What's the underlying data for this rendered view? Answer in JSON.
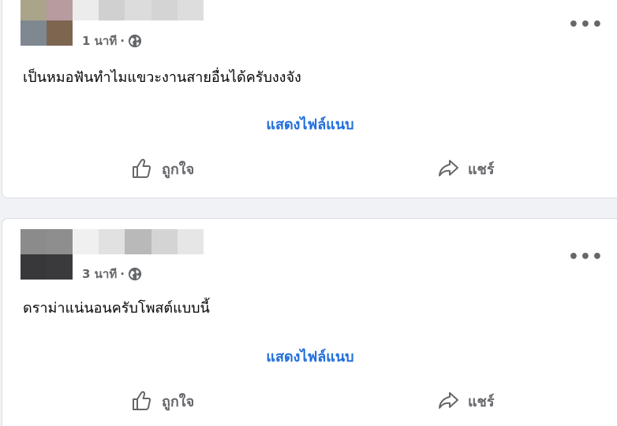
{
  "posts": [
    {
      "time": "1 นาที",
      "separator": "·",
      "audience_icon": "globe-icon",
      "text": "เป็นหมอฟันทำไมแขวะงานสายอื่นได้ครับงงจัง",
      "attachment_label": "แสดงไฟล์แนบ",
      "like_label": "ถูกใจ",
      "share_label": "แชร์",
      "more_icon": "more-dots-icon",
      "more_label": "•••"
    },
    {
      "time": "3 นาที",
      "separator": "·",
      "audience_icon": "globe-icon",
      "text": "ดราม่าแน่นอนครับโพสต์แบบนี้",
      "attachment_label": "แสดงไฟล์แนบ",
      "like_label": "ถูกใจ",
      "share_label": "แชร์",
      "more_icon": "more-dots-icon",
      "more_label": "•••"
    }
  ],
  "colors": {
    "link": "#216fdb",
    "secondary_text": "#65676b",
    "primary_text": "#050505",
    "card_border": "#dadde1",
    "page_background": "#f0f2f5"
  },
  "redaction": {
    "post1_avatar": [
      "#a9a48a",
      "#b79b9e",
      "#7f8791",
      "#7d6650"
    ],
    "post1_name": [
      "#ececec",
      "#d0d0d0",
      "#dcdcdc",
      "#d4d4d4",
      "#dddddd"
    ],
    "post2_avatar": [
      "#8b8b8b",
      "#8e8e8e",
      "#38383b",
      "#3a3a3d"
    ],
    "post2_name": [
      "#f0f0f0",
      "#e1e1e1",
      "#b9b9b9",
      "#d4d4d4",
      "#e6e6e6"
    ]
  }
}
